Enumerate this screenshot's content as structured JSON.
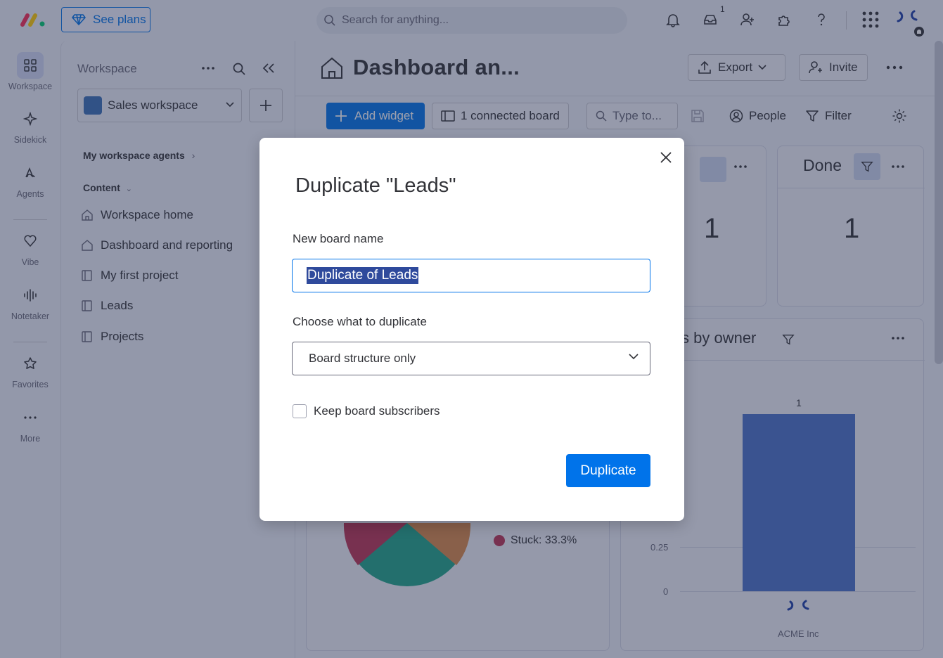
{
  "topbar": {
    "see_plans": "See plans",
    "search_placeholder": "Search for anything...",
    "inbox_badge": "1"
  },
  "rail": {
    "items": [
      {
        "label": "Workspace",
        "icon": "grid-icon"
      },
      {
        "label": "Sidekick",
        "icon": "sparkle-icon"
      },
      {
        "label": "Agents",
        "icon": "agents-icon"
      },
      {
        "label": "Vibe",
        "icon": "heart-icon"
      },
      {
        "label": "Notetaker",
        "icon": "waveform-icon"
      },
      {
        "label": "Favorites",
        "icon": "star-icon"
      },
      {
        "label": "More",
        "icon": "more-icon"
      }
    ]
  },
  "panel": {
    "title": "Workspace",
    "workspace_name": "Sales workspace",
    "agents_label": "My workspace agents",
    "content_label": "Content",
    "nav": [
      {
        "label": "Workspace home",
        "icon": "home-icon"
      },
      {
        "label": "Dashboard and reporting",
        "icon": "dashboard-icon"
      },
      {
        "label": "My first project",
        "icon": "board-icon"
      },
      {
        "label": "Leads",
        "icon": "board-icon"
      },
      {
        "label": "Projects",
        "icon": "board-icon"
      }
    ]
  },
  "main": {
    "title": "Dashboard an...",
    "export_label": "Export",
    "invite_label": "Invite",
    "add_widget": "Add widget",
    "connected_boards": "1 connected board",
    "type_to": "Type to...",
    "people": "People",
    "filter": "Filter",
    "done_card": {
      "title": "Done",
      "value": "1"
    },
    "partial_card": {
      "value": "1"
    },
    "owner_chart": {
      "title_partial": "s by owner",
      "bar_value_label": "1",
      "ytick_025": "0.25",
      "ytick_0": "0",
      "category": "ACME Inc"
    },
    "pie_legend_stuck": "Stuck: 33.3%"
  },
  "modal": {
    "title": "Duplicate \"Leads\"",
    "name_label": "New board name",
    "name_value": "Duplicate of Leads",
    "choose_label": "Choose what to duplicate",
    "choose_value": "Board structure only",
    "keep_subscribers": "Keep board subscribers",
    "keep_subscribers_checked": false,
    "duplicate_button": "Duplicate"
  },
  "colors": {
    "accent": "#0073ea",
    "bar": "#4a72c8",
    "pie_green": "#1fa589",
    "pie_red": "#bb3354",
    "pie_orange": "#d9894a"
  }
}
